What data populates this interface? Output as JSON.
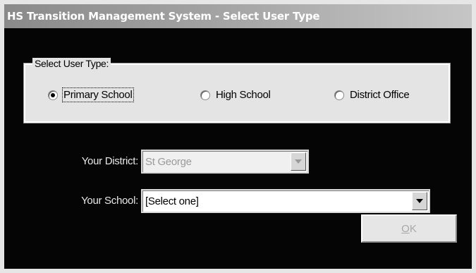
{
  "window": {
    "title": "HS Transition Management System - Select User Type"
  },
  "user_type_group": {
    "legend": "Select User Type:",
    "options": [
      {
        "label": "Primary School",
        "selected": true
      },
      {
        "label": "High School",
        "selected": false
      },
      {
        "label": "District Office",
        "selected": false
      }
    ]
  },
  "district": {
    "label": "Your District:",
    "value": "St George",
    "enabled": false
  },
  "school": {
    "label": "Your School:",
    "value": "[Select one]",
    "enabled": true
  },
  "ok_button": {
    "mnemonic": "O",
    "rest": "K",
    "enabled": false
  }
}
